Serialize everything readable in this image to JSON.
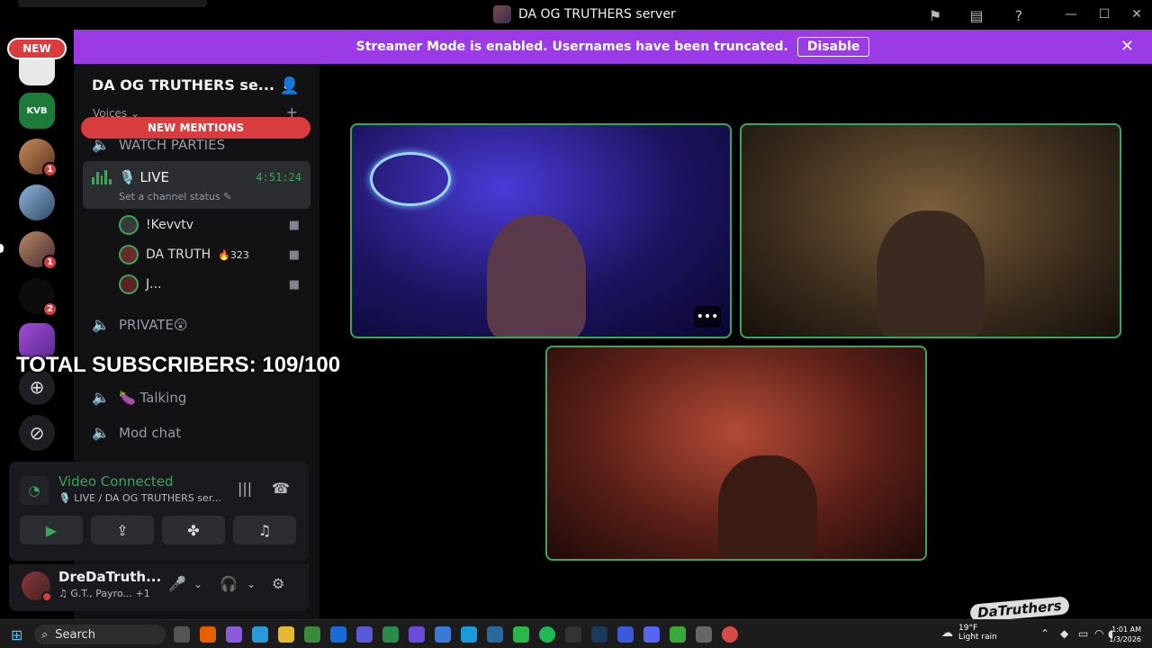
{
  "window": {
    "title": "DA OG TRUTHERS server",
    "controls": [
      "flag-icon",
      "inbox-icon",
      "help-icon",
      "minimize-icon",
      "maximize-icon",
      "close-icon"
    ]
  },
  "banner": {
    "text": "Streamer Mode is enabled. Usernames have been truncated.",
    "disable_label": "Disable",
    "color": "#9b3be6"
  },
  "guilds": {
    "new_label": "NEW",
    "items": [
      {
        "name": "server-1",
        "badge": ""
      },
      {
        "name": "kvb-server",
        "label": "KVB",
        "badge": ""
      },
      {
        "name": "server-3",
        "badge": "1"
      },
      {
        "name": "server-4",
        "badge": ""
      },
      {
        "name": "server-5",
        "badge": "1"
      },
      {
        "name": "phantoms-server",
        "badge": "2"
      },
      {
        "name": "server-7",
        "badge": ""
      }
    ]
  },
  "sidebar": {
    "server_name": "DA OG TRUTHERS se...",
    "category": "Voices",
    "new_mentions": "NEW MENTIONS",
    "channels": {
      "watch_parties": "WATCH PARTIES",
      "live": "LIVE",
      "live_time": "4:51:24",
      "live_status": "Set a channel status",
      "private": "PRIVATE😲",
      "talking": "🍆 Talking",
      "mod_chat": "Mod chat"
    },
    "voice_users": [
      {
        "name": "!Kevvtv",
        "boost": ""
      },
      {
        "name": "DA TRUTH",
        "boost": "323"
      },
      {
        "name": "J...",
        "boost": ""
      }
    ]
  },
  "overlay": {
    "subscribers": "TOTAL SUBSCRIBERS: 109/100"
  },
  "voice_panel": {
    "title": "Video Connected",
    "subtitle": "LIVE / DA OG TRUTHERS ser..."
  },
  "user_panel": {
    "name": "DreDaTruth...",
    "status": "G.T., Payro...",
    "status_extra": "+1"
  },
  "stage": {
    "tiles": [
      "video-tile-kevvtv",
      "video-tile-da-truth",
      "video-tile-j"
    ],
    "border_color": "#3ba55d",
    "watermark": "DaTruthers"
  },
  "taskbar": {
    "search_label": "Search",
    "weather_temp": "19°F",
    "weather_desc": "Light rain",
    "time": "1:01 AM",
    "date": "1/3/2026"
  }
}
